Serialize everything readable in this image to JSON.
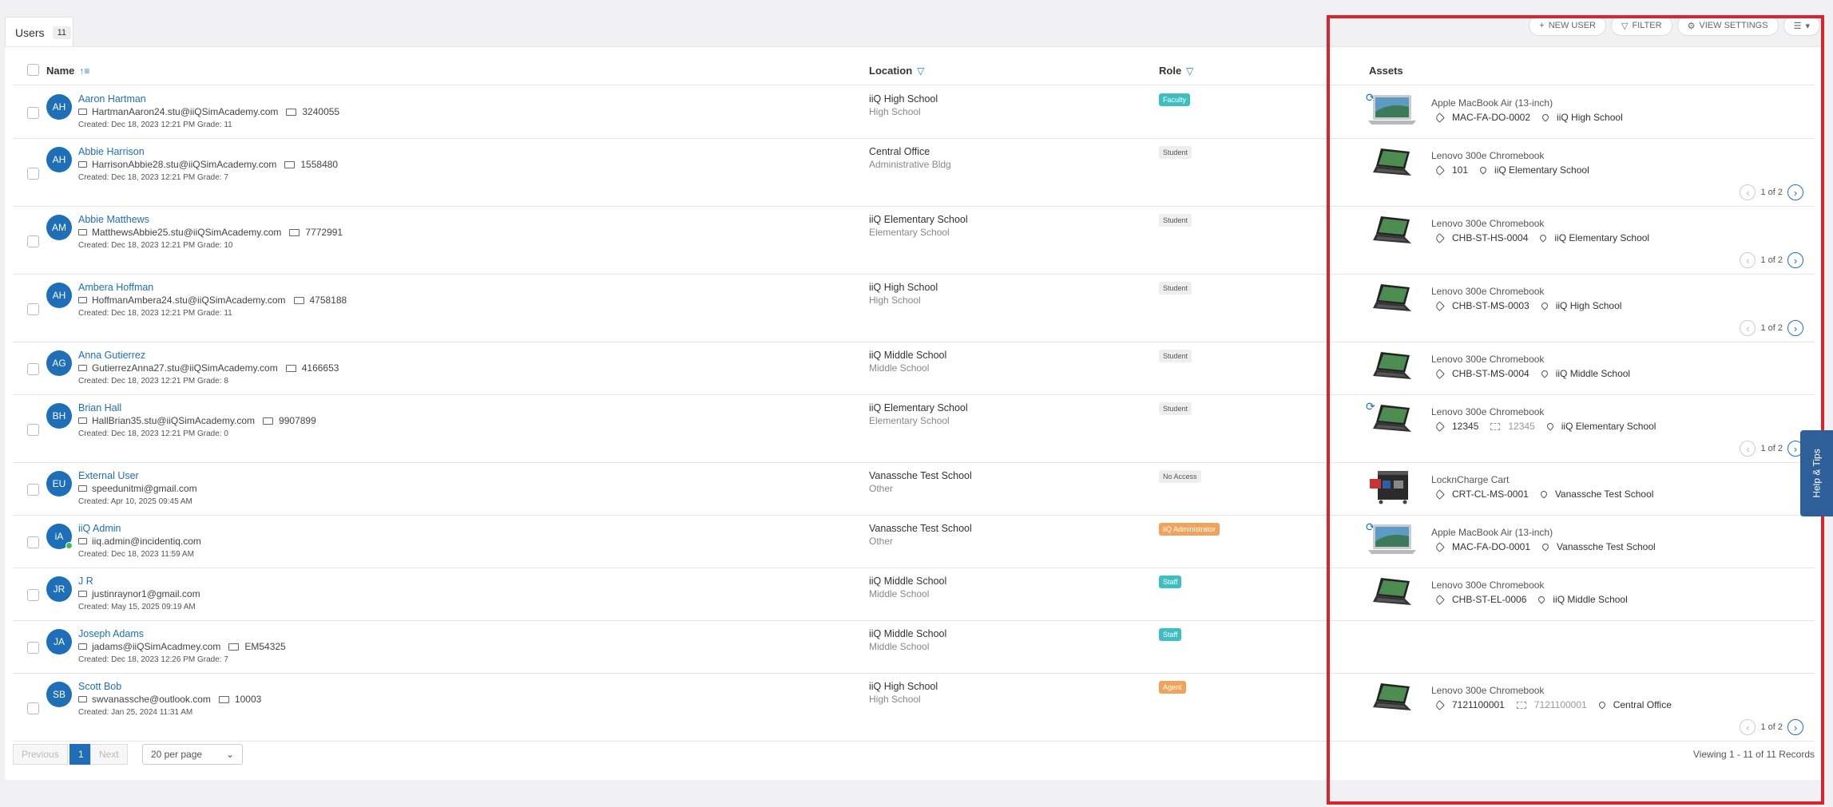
{
  "tab": {
    "label": "Users",
    "count": "11"
  },
  "toolbar": {
    "new_user": "NEW USER",
    "filter": "FILTER",
    "view_settings": "VIEW SETTINGS"
  },
  "columns": {
    "name": "Name",
    "location": "Location",
    "role": "Role",
    "assets": "Assets"
  },
  "role_colors": {
    "Faculty": "#3dbfc1",
    "Student": "#eeeeee",
    "No Access": "#eeeeee",
    "iiQ Administrator": "#f0a35a",
    "Staff": "#3dbfc1",
    "Agent": "#f0a35a"
  },
  "users": [
    {
      "initials": "AH",
      "name": "Aaron Hartman",
      "email": "HartmanAaron24.stu@iiQSimAcademy.com",
      "id": "3240055",
      "created": "Created: Dec 18, 2023 12:21 PM Grade: 11",
      "loc": "iiQ High School",
      "subloc": "High School",
      "role": "Faculty",
      "online": false,
      "asset": {
        "name": "Apple MacBook Air (13-inch)",
        "tag": "MAC-FA-DO-0002",
        "serial": "",
        "loc": "iiQ High School",
        "type": "laptop",
        "sync": true,
        "pager": ""
      }
    },
    {
      "initials": "AH",
      "name": "Abbie Harrison",
      "email": "HarrisonAbbie28.stu@iiQSimAcademy.com",
      "id": "1558480",
      "created": "Created: Dec 18, 2023 12:21 PM Grade: 7",
      "loc": "Central Office",
      "subloc": "Administrative Bldg",
      "role": "Student",
      "online": false,
      "asset": {
        "name": "Lenovo 300e Chromebook",
        "tag": "101",
        "serial": "",
        "loc": "iiQ Elementary School",
        "type": "chromebook",
        "sync": false,
        "pager": "1 of 2"
      }
    },
    {
      "initials": "AM",
      "name": "Abbie Matthews",
      "email": "MatthewsAbbie25.stu@iiQSimAcademy.com",
      "id": "7772991",
      "created": "Created: Dec 18, 2023 12:21 PM Grade: 10",
      "loc": "iiQ Elementary School",
      "subloc": "Elementary School",
      "role": "Student",
      "online": false,
      "asset": {
        "name": "Lenovo 300e Chromebook",
        "tag": "CHB-ST-HS-0004",
        "serial": "",
        "loc": "iiQ Elementary School",
        "type": "chromebook",
        "sync": false,
        "pager": "1 of 2"
      }
    },
    {
      "initials": "AH",
      "name": "Ambera Hoffman",
      "email": "HoffmanAmbera24.stu@iiQSimAcademy.com",
      "id": "4758188",
      "created": "Created: Dec 18, 2023 12:21 PM Grade: 11",
      "loc": "iiQ High School",
      "subloc": "High School",
      "role": "Student",
      "online": false,
      "asset": {
        "name": "Lenovo 300e Chromebook",
        "tag": "CHB-ST-MS-0003",
        "serial": "",
        "loc": "iiQ High School",
        "type": "chromebook",
        "sync": false,
        "pager": "1 of 2"
      }
    },
    {
      "initials": "AG",
      "name": "Anna Gutierrez",
      "email": "GutierrezAnna27.stu@iiQSimAcademy.com",
      "id": "4166653",
      "created": "Created: Dec 18, 2023 12:21 PM Grade: 8",
      "loc": "iiQ Middle School",
      "subloc": "Middle School",
      "role": "Student",
      "online": false,
      "asset": {
        "name": "Lenovo 300e Chromebook",
        "tag": "CHB-ST-MS-0004",
        "serial": "",
        "loc": "iiQ Middle School",
        "type": "chromebook",
        "sync": false,
        "pager": ""
      }
    },
    {
      "initials": "BH",
      "name": "Brian Hall",
      "email": "HallBrian35.stu@iiQSimAcademy.com",
      "id": "9907899",
      "created": "Created: Dec 18, 2023 12:21 PM Grade: 0",
      "loc": "iiQ Elementary School",
      "subloc": "Elementary School",
      "role": "Student",
      "online": false,
      "asset": {
        "name": "Lenovo 300e Chromebook",
        "tag": "12345",
        "serial": "12345",
        "loc": "iiQ Elementary School",
        "type": "chromebook",
        "sync": true,
        "pager": "1 of 2"
      }
    },
    {
      "initials": "EU",
      "name": "External User",
      "email": "speedunitmi@gmail.com",
      "id": "",
      "created": "Created: Apr 10, 2025 09:45 AM",
      "loc": "Vanassche Test School",
      "subloc": "Other",
      "role": "No Access",
      "online": false,
      "asset": {
        "name": "LocknCharge Cart",
        "tag": "CRT-CL-MS-0001",
        "serial": "",
        "loc": "Vanassche Test School",
        "type": "cart",
        "sync": false,
        "pager": ""
      }
    },
    {
      "initials": "iA",
      "name": "iiQ Admin",
      "email": "iiq.admin@incidentiq.com",
      "id": "",
      "created": "Created: Dec 18, 2023 11:59 AM",
      "loc": "Vanassche Test School",
      "subloc": "Other",
      "role": "iiQ Administrator",
      "online": true,
      "asset": {
        "name": "Apple MacBook Air (13-inch)",
        "tag": "MAC-FA-DO-0001",
        "serial": "",
        "loc": "Vanassche Test School",
        "type": "laptop",
        "sync": true,
        "pager": ""
      }
    },
    {
      "initials": "JR",
      "name": "J R",
      "email": "justinraynor1@gmail.com",
      "id": "",
      "created": "Created: May 15, 2025 09:19 AM",
      "loc": "iiQ Middle School",
      "subloc": "Middle School",
      "role": "Staff",
      "online": false,
      "asset": {
        "name": "Lenovo 300e Chromebook",
        "tag": "CHB-ST-EL-0006",
        "serial": "",
        "loc": "iiQ Middle School",
        "type": "chromebook",
        "sync": false,
        "pager": ""
      }
    },
    {
      "initials": "JA",
      "name": "Joseph Adams",
      "email": "jadams@iiQSimAcadmey.com",
      "id": "EM54325",
      "created": "Created: Dec 18, 2023 12:26 PM Grade: 7",
      "loc": "iiQ Middle School",
      "subloc": "Middle School",
      "role": "Staff",
      "online": false,
      "asset": null
    },
    {
      "initials": "SB",
      "name": "Scott Bob",
      "email": "swvanassche@outlook.com",
      "id": "10003",
      "created": "Created: Jan 25, 2024 11:31 AM",
      "loc": "iiQ High School",
      "subloc": "High School",
      "role": "Agent",
      "online": false,
      "asset": {
        "name": "Lenovo 300e Chromebook",
        "tag": "7121100001",
        "serial": "7121100001",
        "loc": "Central Office",
        "type": "chromebook",
        "sync": false,
        "pager": "1 of 2"
      }
    }
  ],
  "footer": {
    "previous": "Previous",
    "page": "1",
    "next": "Next",
    "per_page": "20 per page",
    "viewing": "Viewing 1 - 11 of 11 Records"
  },
  "help": "Help & Tips"
}
